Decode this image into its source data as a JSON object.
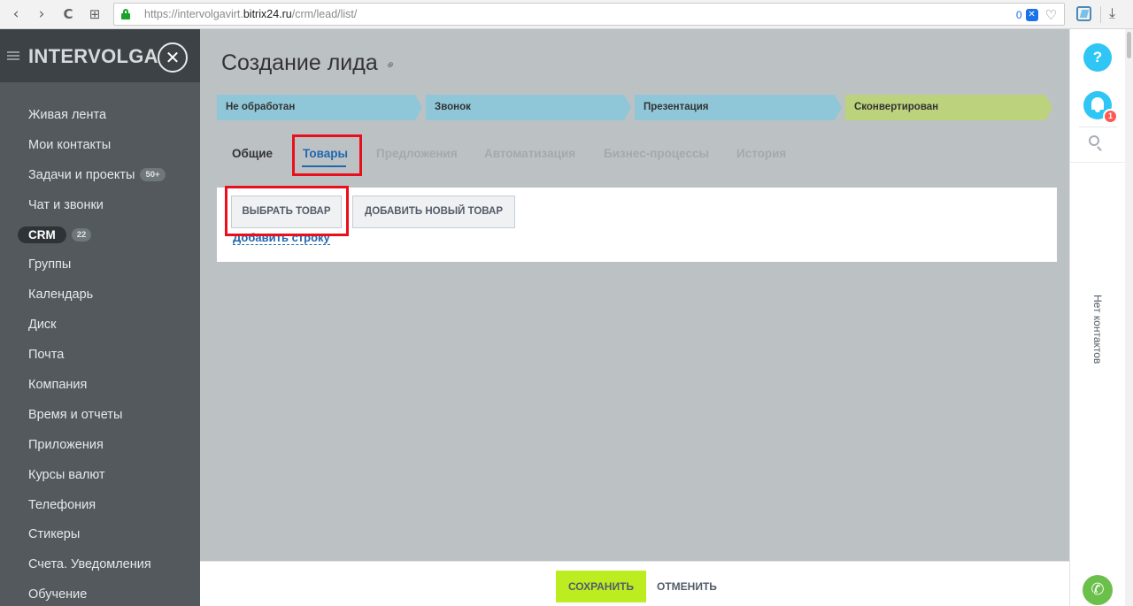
{
  "browser": {
    "url_prefix": "https://intervolgavirt.",
    "url_domain": "bitrix24.ru",
    "url_path": "/crm/lead/list/",
    "adblock_count": "0",
    "nav_back": "‹",
    "nav_forward": "›",
    "nav_reload": "C",
    "nav_grid": "⊞",
    "heart": "♡",
    "download": "⤓"
  },
  "sidebar": {
    "logo": "INTERVOLGA",
    "close_glyph": "✕",
    "items": [
      {
        "label": "Живая лента"
      },
      {
        "label": "Мои контакты"
      },
      {
        "label": "Задачи и проекты",
        "badge": "50+"
      },
      {
        "label": "Чат и звонки"
      },
      {
        "label": "CRM",
        "badge": "22"
      },
      {
        "label": "Группы"
      },
      {
        "label": "Календарь"
      },
      {
        "label": "Диск"
      },
      {
        "label": "Почта"
      },
      {
        "label": "Компания"
      },
      {
        "label": "Время и отчеты"
      },
      {
        "label": "Приложения"
      },
      {
        "label": "Курсы валют"
      },
      {
        "label": "Телефония"
      },
      {
        "label": "Стикеры"
      },
      {
        "label": "Счета. Уведомления"
      },
      {
        "label": "Обучение"
      }
    ]
  },
  "page": {
    "title": "Создание лида",
    "link_glyph": "⚭"
  },
  "stages": [
    {
      "label": "Не обработан",
      "color": "#8fc7d8"
    },
    {
      "label": "Звонок",
      "color": "#8fc7d8"
    },
    {
      "label": "Презентация",
      "color": "#8fc7d8"
    },
    {
      "label": "Сконвертирован",
      "color": "#bdd27c"
    }
  ],
  "tabs": [
    {
      "label": "Общие",
      "state": "normal"
    },
    {
      "label": "Товары",
      "state": "active"
    },
    {
      "label": "Предложения",
      "state": "dim"
    },
    {
      "label": "Автоматизация",
      "state": "dim"
    },
    {
      "label": "Бизнес-процессы",
      "state": "dim"
    },
    {
      "label": "История",
      "state": "dim"
    }
  ],
  "products": {
    "select_button": "ВЫБРАТЬ ТОВАР",
    "add_new_button": "ДОБАВИТЬ НОВЫЙ ТОВАР",
    "add_row_link": "Добавить строку"
  },
  "footer": {
    "save": "СОХРАНИТЬ",
    "cancel": "ОТМЕНИТЬ"
  },
  "right_panel": {
    "help": "?",
    "notification_count": "1",
    "no_contacts": "Нет контактов",
    "phone_glyph": "✆"
  },
  "colors": {
    "accent_blue": "#2067b0",
    "save_green": "#bbed21",
    "highlight_red": "#e8101c",
    "sidebar_bg": "#53595d"
  }
}
